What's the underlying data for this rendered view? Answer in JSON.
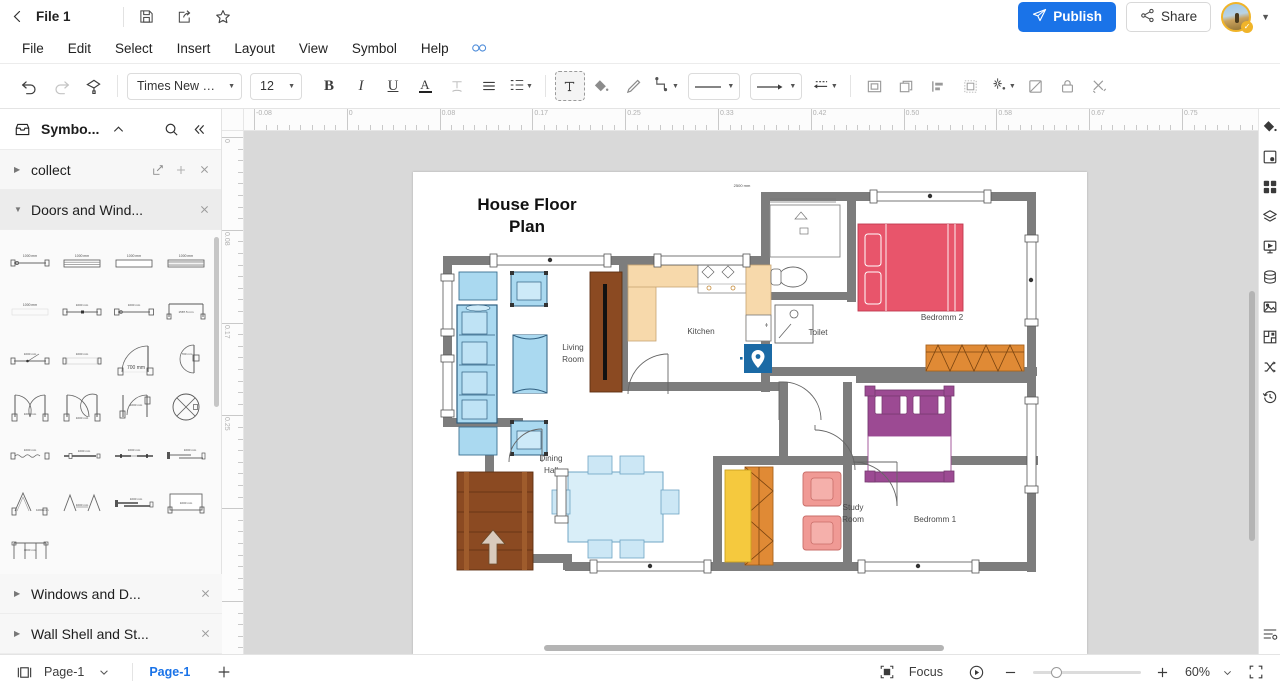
{
  "titlebar": {
    "file_name": "File 1",
    "back_icon": "chevron-left-icon",
    "save_icon": "save-icon",
    "export_icon": "export-icon",
    "favorite_icon": "star-icon",
    "publish_label": "Publish",
    "share_label": "Share",
    "avatar_badge": "✓"
  },
  "menubar": {
    "items": [
      {
        "label": "File"
      },
      {
        "label": "Edit"
      },
      {
        "label": "Select"
      },
      {
        "label": "Insert"
      },
      {
        "label": "Layout"
      },
      {
        "label": "View"
      },
      {
        "label": "Symbol"
      },
      {
        "label": "Help"
      }
    ],
    "trailing_icon": "infinity-icon"
  },
  "toolbar": {
    "undo_icon": "undo-icon",
    "redo_icon": "redo-icon",
    "format_painter_icon": "format-painter-icon",
    "font_family": "Times New Ro...",
    "font_size": "12",
    "bold_label": "B",
    "italic_label": "I",
    "underline_label": "U",
    "font_color_label": "A",
    "strike_icon": "text-effect-icon",
    "align_icon": "align-left-icon",
    "line_spacing_icon": "line-spacing-icon",
    "text_box_icon": "text-box-icon",
    "fill_icon": "fill-color-icon",
    "pen_icon": "pen-icon",
    "connector_icon": "connector-icon",
    "line_style_icon": "line-style-icon",
    "arrow_style_icon": "arrow-style-icon",
    "dash_arrow_icon": "dashed-arrow-icon",
    "group_icon": "group-icon",
    "duplicate_icon": "duplicate-icon",
    "align_objects_icon": "align-objects-icon",
    "container_icon": "container-icon",
    "effects_icon": "effects-icon",
    "no_fill_icon": "no-fill-icon",
    "lock_icon": "lock-icon",
    "tools_icon": "tools-icon"
  },
  "left_panel": {
    "title": "Symbo...",
    "panel_icon": "symbol-library-icon",
    "collapse_icon": "chevron-up-icon",
    "search_icon": "search-icon",
    "collapse_panel_icon": "double-chevron-left-icon",
    "libraries": [
      {
        "label": "collect",
        "expanded": false,
        "actions": [
          "edit-icon",
          "plus-icon",
          "close-icon"
        ]
      },
      {
        "label": "Doors and Wind...",
        "expanded": true,
        "actions": [
          "close-icon"
        ]
      }
    ],
    "bottom_libraries": [
      {
        "label": "Windows and D...",
        "expanded": false,
        "actions": [
          "close-icon"
        ]
      },
      {
        "label": "Wall Shell and St...",
        "expanded": false,
        "actions": [
          "close-icon"
        ]
      }
    ],
    "symbols": [
      {
        "name": "single-door-symbol",
        "dim": "1000 mm"
      },
      {
        "name": "double-window-symbol",
        "dim": "1000 mm"
      },
      {
        "name": "plain-window-symbol",
        "dim": "1000 mm"
      },
      {
        "name": "louvered-window-symbol",
        "dim": "1000 mm"
      },
      {
        "name": "opening-symbol",
        "dim": "1000 mm"
      },
      {
        "name": "double-leaf-door-symbol",
        "dim": "1000 mm"
      },
      {
        "name": "sliding-door-symbol",
        "dim": "1000 mm"
      },
      {
        "name": "bay-window-symbol",
        "dim": "1587.5 mm"
      },
      {
        "name": "pivot-door-symbol",
        "dim": "1000 mm"
      },
      {
        "name": "flush-window-symbol",
        "dim": "1000 mm"
      },
      {
        "name": "swing-door-symbol",
        "dim": "700 mm"
      },
      {
        "name": "round-swing-door-symbol",
        "dim": "700 mm"
      },
      {
        "name": "double-swing-door-symbol",
        "dim": "1000 mm"
      },
      {
        "name": "double-swing-door-alt-symbol",
        "dim": "1000 mm"
      },
      {
        "name": "corner-door-symbol",
        "dim": "1000 mm"
      },
      {
        "name": "revolving-door-symbol",
        "dim": ""
      },
      {
        "name": "curtain-symbol",
        "dim": "1000 mm"
      },
      {
        "name": "bar-window-symbol",
        "dim": "1000 mm"
      },
      {
        "name": "double-bar-window-symbol",
        "dim": "1000 mm"
      },
      {
        "name": "sliding-window-symbol",
        "dim": "1000 mm"
      },
      {
        "name": "single-gable-symbol",
        "dim": "1000 mm"
      },
      {
        "name": "double-gable-symbol",
        "dim": "1000 mm"
      },
      {
        "name": "pocket-door-symbol",
        "dim": "1000 mm"
      },
      {
        "name": "panel-window-symbol",
        "dim": "1000 mm"
      },
      {
        "name": "triple-window-symbol",
        "dim": "1000 mm"
      }
    ]
  },
  "canvas": {
    "ruler_h_labels": [
      "-0.08",
      "0",
      "0.08",
      "0.17",
      "0.25",
      "0.33",
      "0.42",
      "0.50",
      "0.58",
      "0.67",
      "0.75"
    ],
    "ruler_v_labels": [
      "0",
      "0.08",
      "0.17",
      "0.25"
    ],
    "floorplan": {
      "title_line1": "House Floor",
      "title_line2": "Plan",
      "rooms": [
        {
          "name": "living-room",
          "label_line1": "Living",
          "label_line2": "Room"
        },
        {
          "name": "kitchen",
          "label_line1": "Kitchen",
          "label_line2": ""
        },
        {
          "name": "toilet",
          "label_line1": "Toilet",
          "label_line2": ""
        },
        {
          "name": "bedroom-2",
          "label_line1": "Bedromm 2",
          "label_line2": ""
        },
        {
          "name": "bedroom-1",
          "label_line1": "Bedromm 1",
          "label_line2": ""
        },
        {
          "name": "dining-hall",
          "label_line1": "Dining",
          "label_line2": "Hall"
        },
        {
          "name": "study-room",
          "label_line1": "Study",
          "label_line2": "Room"
        }
      ],
      "colors": {
        "wall": "#7d7d7d",
        "furniture_blue": "#aad9f0",
        "bed_red": "#e8556b",
        "bed_purple": "#9c4a93",
        "counter_tan": "#f7d9ab",
        "wood_brown": "#8b4a22",
        "cabinet_orange": "#e08a35",
        "curtain_yellow": "#f5c93e",
        "chair_pink": "#f09a95",
        "marker_blue": "#1b6aa5"
      }
    }
  },
  "right_rail": {
    "icons": [
      {
        "name": "fill-color-icon"
      },
      {
        "name": "page-setup-icon"
      },
      {
        "name": "grid-symbols-icon"
      },
      {
        "name": "layers-icon"
      },
      {
        "name": "presentation-icon"
      },
      {
        "name": "data-icon"
      },
      {
        "name": "image-icon"
      },
      {
        "name": "floorplan-icon"
      },
      {
        "name": "shuffle-icon"
      },
      {
        "name": "history-icon"
      }
    ],
    "bottom_icon": {
      "name": "list-settings-icon"
    }
  },
  "statusbar": {
    "page_view_icon": "page-view-icon",
    "page_select_label": "Page-1",
    "page_select_caret": "chevron-down-icon",
    "page_tab_label": "Page-1",
    "add_page_icon": "plus-icon",
    "focus_icon": "focus-icon",
    "focus_label": "Focus",
    "play_icon": "play-icon",
    "zoom_out_icon": "minus-icon",
    "zoom_in_icon": "plus-icon",
    "zoom_value": "60%",
    "zoom_caret": "chevron-down-icon",
    "fullscreen_icon": "fullscreen-icon"
  }
}
